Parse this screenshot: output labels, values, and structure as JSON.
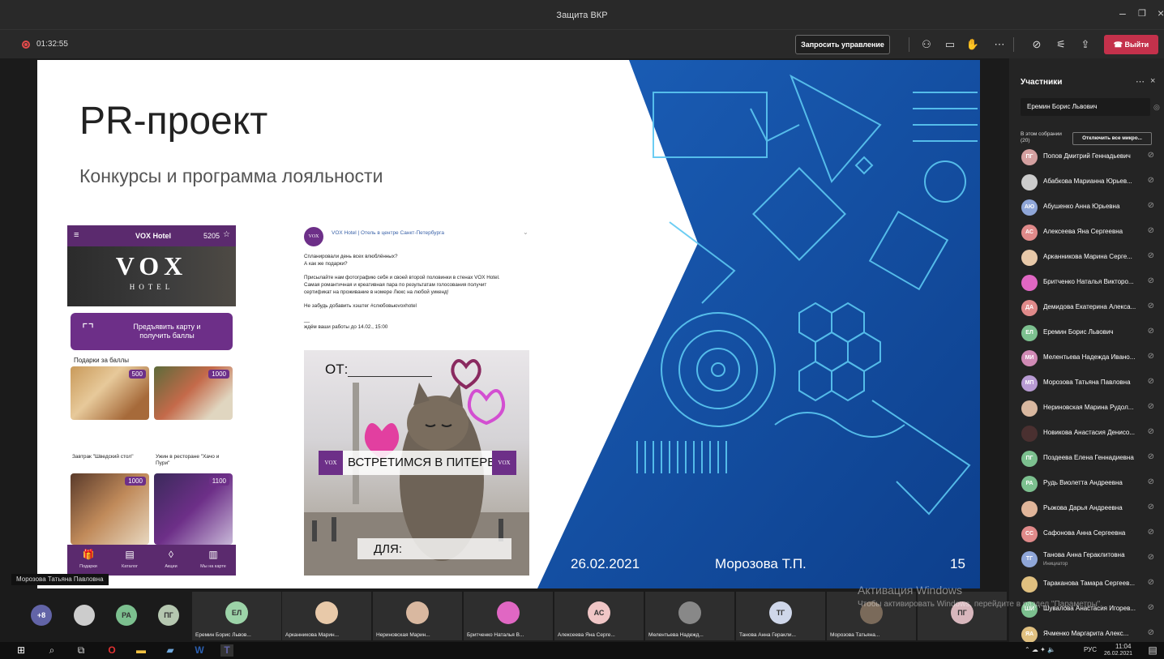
{
  "window": {
    "title": "Защита ВКР"
  },
  "toolbar": {
    "rec_time": "01:32:55",
    "request_control": "Запросить управление",
    "leave": "Выйти"
  },
  "slide": {
    "title": "PR-проект",
    "subtitle": "Конкурсы и программа лояльности",
    "date": "26.02.2021",
    "author": "Морозова Т.П.",
    "page": "15",
    "app": {
      "hotel": "VOX Hotel",
      "points": "5205",
      "logo_big": "VOX",
      "logo_small": "HOTEL",
      "card_line1": "Предъявить карту и",
      "card_line2": "получить баллы",
      "gifts_title": "Подарки за баллы",
      "gifts": [
        {
          "price": "500",
          "caption": "Завтрак \"Шведский стол\""
        },
        {
          "price": "1000",
          "caption": "Ужин в ресторане \"Хачо и Пури\""
        },
        {
          "price": "1000",
          "caption": ""
        },
        {
          "price": "1100",
          "caption": ""
        }
      ],
      "nav": [
        "Подарки",
        "Каталог",
        "Акции",
        "Мы на карте"
      ]
    },
    "post": {
      "avatar": "VOX",
      "name": "VOX Hotel | Отель в центре Санкт-Петербурга",
      "line1": "Спланировали день всех влюблённых?",
      "line2": "А как же подарки?",
      "line3": "Присылайте нам фотографию себя и своей второй половинки в стенах VOX Hotel.",
      "line4": "Самая романтичная и креативная пара по результатам голосования получит",
      "line5": "сертификат на проживание в номере Люкс на любой уикенд!",
      "line6": "Не забудь добавить хэштег #слюбовьюvoxhotel",
      "line7": "__",
      "line8": "ждём ваши работы до 14.02., 15:00",
      "ot": "ОТ:",
      "banner": "ВСТРЕТИМСЯ В ПИТЕРЕ",
      "dla": "ДЛЯ:",
      "vox_mini": "VOX"
    }
  },
  "presenter_tag": "Морозова Татьяна Павловна",
  "panel": {
    "title": "Участники",
    "search_value": "Еремин Борис Львович",
    "section": "В этом собрании (20)",
    "mute_all": "Отключить все микро...",
    "participants": [
      {
        "initials": "ПГ",
        "name": "Попов Дмитрий Геннадьевич",
        "color": "#d4a0a0",
        "sub": ""
      },
      {
        "initials": "",
        "name": "Абабкова Марианна Юрьев...",
        "color": "#cccccc",
        "sub": ""
      },
      {
        "initials": "АЮ",
        "name": "Абушенко Анна Юрьевна",
        "color": "#8fa6d8",
        "sub": ""
      },
      {
        "initials": "АС",
        "name": "Алексеева Яна Сергеевна",
        "color": "#e08a8a",
        "sub": ""
      },
      {
        "initials": "",
        "name": "Арканникова Марина Серге...",
        "color": "#e8c9a9",
        "sub": ""
      },
      {
        "initials": "",
        "name": "Бритченко Наталья Викторо...",
        "color": "#e067c3",
        "sub": ""
      },
      {
        "initials": "ДА",
        "name": "Демидова Екатерина Алекса...",
        "color": "#e08a8a",
        "sub": ""
      },
      {
        "initials": "ЕЛ",
        "name": "Еремин Борис Львович",
        "color": "#7cc08f",
        "sub": ""
      },
      {
        "initials": "МИ",
        "name": "Мелентьева Надежда Ивано...",
        "color": "#d08ab5",
        "sub": ""
      },
      {
        "initials": "МП",
        "name": "Морозова Татьяна Павловна",
        "color": "#b89bd3",
        "sub": ""
      },
      {
        "initials": "",
        "name": "Нериновская Марина Рудол...",
        "color": "#d9b8a0",
        "sub": ""
      },
      {
        "initials": "",
        "name": "Новикова Анастасия Денисо...",
        "color": "#4a3030",
        "sub": ""
      },
      {
        "initials": "ПГ",
        "name": "Поздеева Елена Геннадиевна",
        "color": "#7cc08f",
        "sub": ""
      },
      {
        "initials": "РА",
        "name": "Рудь Виолетта Андреевна",
        "color": "#7cc08f",
        "sub": ""
      },
      {
        "initials": "",
        "name": "Рыжова Дарья Андреевна",
        "color": "#e0b59a",
        "sub": ""
      },
      {
        "initials": "СС",
        "name": "Сафонова Анна Сергеевна",
        "color": "#e08a8a",
        "sub": ""
      },
      {
        "initials": "ТГ",
        "name": "Танова Анна Гераклитовна",
        "color": "#8fa6d8",
        "sub": "Инициатор"
      },
      {
        "initials": "",
        "name": "Тараканова Тамара Сергеев...",
        "color": "#e0c080",
        "sub": ""
      },
      {
        "initials": "ШИ",
        "name": "Шувалова Анастасия Игорев...",
        "color": "#7cc08f",
        "sub": ""
      },
      {
        "initials": "ЯА",
        "name": "Ячменко Маргарита Алекс...",
        "color": "#e0c080",
        "sub": ""
      }
    ]
  },
  "strip": {
    "more": "+8",
    "small": [
      {
        "initials": "",
        "color": "#cccccc"
      },
      {
        "initials": "РА",
        "color": "#7cc08f"
      },
      {
        "initials": "ПГ",
        "color": "#b5c7b0"
      }
    ],
    "tiles": [
      {
        "initials": "ЕЛ",
        "name": "Еремин Борис Львов...",
        "color": "#9cd3a8"
      },
      {
        "initials": "",
        "name": "Арканникова Марин...",
        "color": "#e8c9a9"
      },
      {
        "initials": "",
        "name": "Нериновская Марин...",
        "color": "#d9b8a0"
      },
      {
        "initials": "",
        "name": "Бритченко Наталья В...",
        "color": "#e067c3"
      },
      {
        "initials": "АС",
        "name": "Алексеева Яна Серге...",
        "color": "#f0c6c6"
      },
      {
        "initials": "",
        "name": "Мелентьева Надежд...",
        "color": "#888888"
      },
      {
        "initials": "ТГ",
        "name": "Танова Анна Геракли...",
        "color": "#cfd7ea"
      },
      {
        "initials": "",
        "name": "Морозова Татьяна...",
        "color": "#7a6a5a"
      },
      {
        "initials": "ПГ",
        "name": "",
        "color": "#d8b7bd"
      }
    ]
  },
  "watermark": {
    "line1": "Активация Windows",
    "line2": "Чтобы активировать Windows, перейдите в раздел \"Параметры\"."
  },
  "taskbar": {
    "lang": "РУС",
    "time": "11:04",
    "date": "26.02.2021"
  }
}
